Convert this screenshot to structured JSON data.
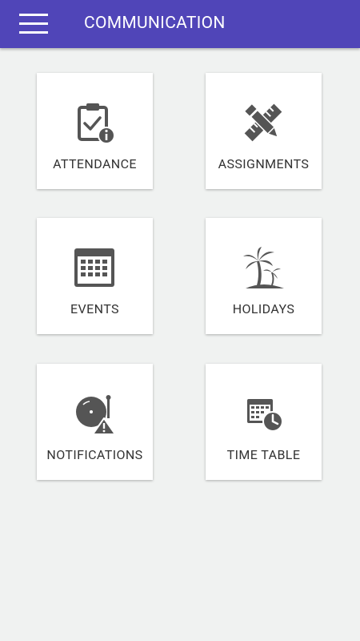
{
  "app_bar": {
    "title": "COMMUNICATION",
    "menu_icon": "hamburger-menu-icon",
    "color": "#5045b8"
  },
  "tiles": [
    {
      "label": "ATTENDANCE",
      "icon": "attendance-clipboard-icon"
    },
    {
      "label": "ASSIGNMENTS",
      "icon": "ruler-pencil-icon"
    },
    {
      "label": "EVENTS",
      "icon": "calendar-icon"
    },
    {
      "label": "HOLIDAYS",
      "icon": "palm-tree-icon"
    },
    {
      "label": "NOTIFICATIONS",
      "icon": "alarm-bell-icon"
    },
    {
      "label": "TIME TABLE",
      "icon": "calendar-clock-icon"
    }
  ],
  "colors": {
    "background": "#f0f2f1",
    "tile": "#ffffff",
    "icon": "#555555",
    "text": "#333333"
  }
}
